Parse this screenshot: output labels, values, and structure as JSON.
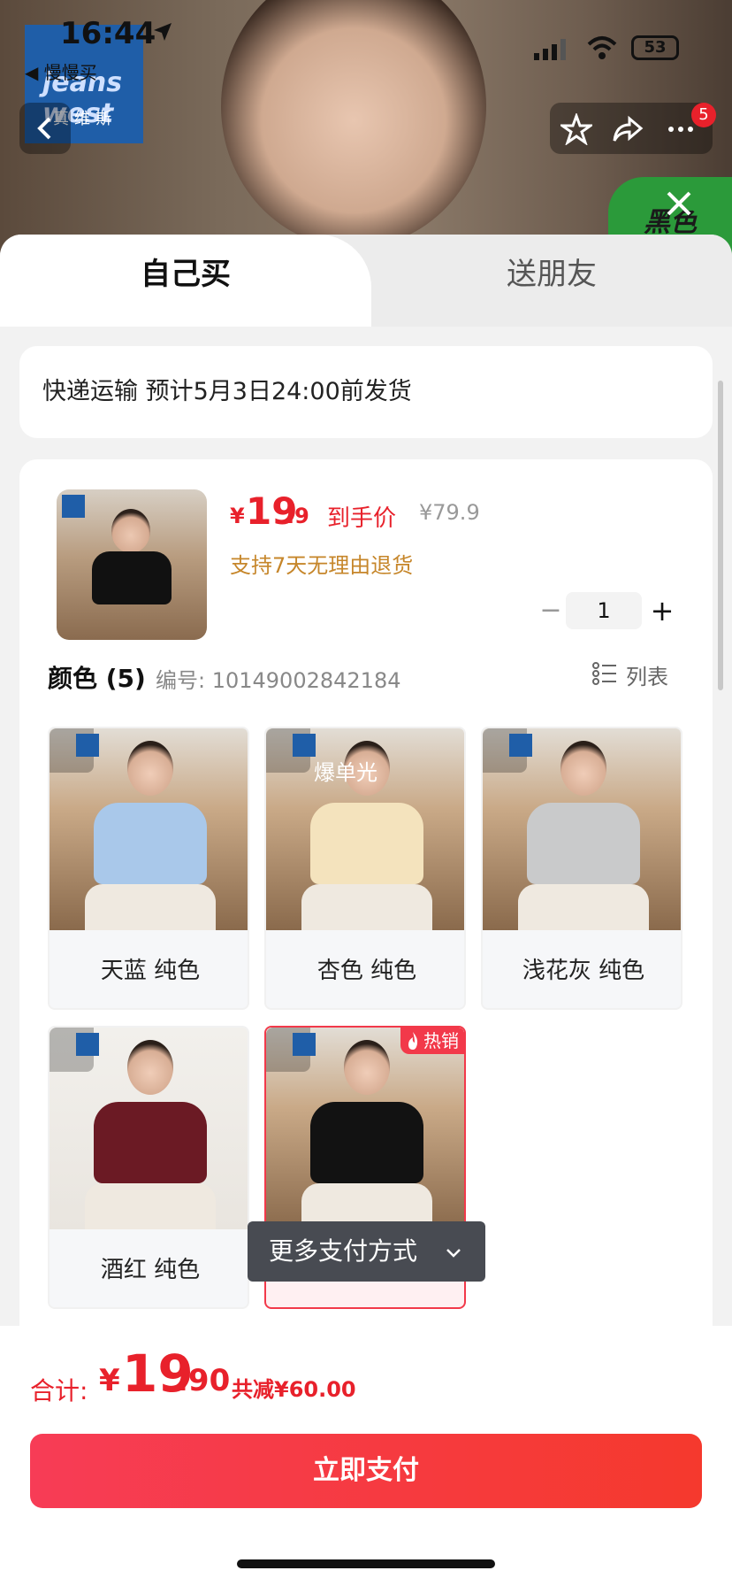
{
  "status_bar": {
    "time": "16:44",
    "back_app": "◀ 慢慢买",
    "battery": "53"
  },
  "hero": {
    "brand_en": "jeans west",
    "brand_cn": "真维斯",
    "green_badge": "黑色",
    "cart_badge": "5"
  },
  "tabs": [
    {
      "label": "自己买"
    },
    {
      "label": "送朋友"
    }
  ],
  "shipping": {
    "text": "快递运输 预计5月3日24:00前发货"
  },
  "product": {
    "price_yen": "¥",
    "price_int": "19",
    "price_dec": ".9",
    "price_tag": "到手价",
    "original_price": "¥79.9",
    "return_policy": "支持7天无理由退货",
    "quantity": "1",
    "minus": "−",
    "plus": "+"
  },
  "colors": {
    "label": "颜色 (5)",
    "code": "编号: 10149002842184",
    "list_label": "列表",
    "items": [
      {
        "name": "天蓝 纯色",
        "shirt_color": "#a9c8ea"
      },
      {
        "name": "杏色 纯色",
        "shirt_color": "#f4e3bd",
        "overlay": "爆单光"
      },
      {
        "name": "浅花灰 纯色",
        "shirt_color": "#c9cacb"
      },
      {
        "name": "酒红 纯色",
        "shirt_color": "#6b1a24"
      },
      {
        "name": "",
        "shirt_color": "#121212",
        "badge": "热销",
        "selected": true
      }
    ]
  },
  "more_payment": {
    "label": "更多支付方式"
  },
  "summary": {
    "label": "合计:",
    "yen": "¥",
    "int": "19",
    "dec": ".90",
    "saved": "共减¥60.00"
  },
  "pay_button": {
    "label": "立即支付"
  },
  "colors_theme": {
    "accent": "#e8212b",
    "button_start": "#f73c56",
    "button_end": "#f5392d",
    "gold": "#c6862a"
  }
}
